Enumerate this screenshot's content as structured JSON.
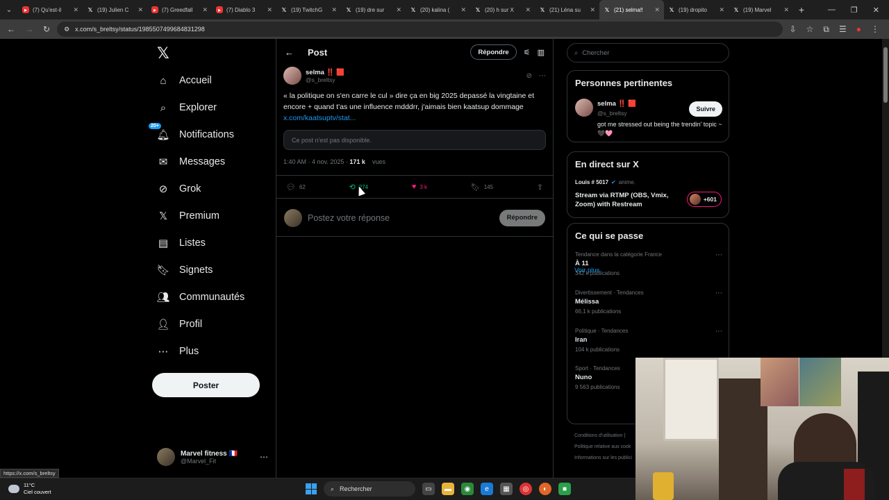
{
  "browser": {
    "tabs": [
      {
        "title": "(7) Qu'est-il",
        "icon": "youtube-icon"
      },
      {
        "title": "(19) Julien C",
        "icon": "x-icon"
      },
      {
        "title": "(7) Greedfall",
        "icon": "youtube-icon"
      },
      {
        "title": "(7) Diablo 3",
        "icon": "youtube-icon"
      },
      {
        "title": "(19) TwitchG",
        "icon": "x-icon"
      },
      {
        "title": "(19) dre sur",
        "icon": "x-icon"
      },
      {
        "title": "(20) kalina (",
        "icon": "x-icon"
      },
      {
        "title": "(20) h sur X",
        "icon": "x-icon"
      },
      {
        "title": "(21) Léna su",
        "icon": "x-icon"
      },
      {
        "title": "(21) selma‼",
        "icon": "x-icon",
        "active": true
      },
      {
        "title": "(19) dropito",
        "icon": "x-icon"
      },
      {
        "title": "(19) Marvel",
        "icon": "x-icon"
      }
    ],
    "url": "x.com/s_breltsy/status/1985507499684831298",
    "status_url": "https://x.com/s_breltsy"
  },
  "nav": {
    "items": [
      {
        "label": "Accueil",
        "icon": "home-icon"
      },
      {
        "label": "Explorer",
        "icon": "search-icon"
      },
      {
        "label": "Notifications",
        "icon": "bell-icon",
        "badge": "20+"
      },
      {
        "label": "Messages",
        "icon": "mail-icon"
      },
      {
        "label": "Grok",
        "icon": "grok-icon"
      },
      {
        "label": "Premium",
        "icon": "x-logo-icon"
      },
      {
        "label": "Listes",
        "icon": "list-icon"
      },
      {
        "label": "Signets",
        "icon": "bookmark-icon"
      },
      {
        "label": "Communautés",
        "icon": "communities-icon"
      },
      {
        "label": "Profil",
        "icon": "profile-icon"
      },
      {
        "label": "Plus",
        "icon": "more-icon"
      }
    ],
    "post_button": "Poster",
    "account": {
      "name": "Marvel fitness 🇫🇷",
      "handle": "@Marvel_Fit"
    }
  },
  "header": {
    "title": "Post",
    "reply_button": "Répondre"
  },
  "tweet": {
    "name": "selma",
    "name_emoji": "‼️ 🟥",
    "handle": "@s_breltsy",
    "text": "« la politique on s'en carre le cul » dire ça en big 2025 depassé la vingtaine et encore + quand t'as une influence mdddrr, j'aimais bien kaatsup dommage ",
    "link": "x.com/kaatsuptv/stat...",
    "unavailable": "Ce post n'est pas disponible.",
    "time": "1:40 AM · 4 nov. 2025 · ",
    "views_count": "171 k",
    "views_label": "vues",
    "replies": "62",
    "reposts": "274",
    "likes": "3 k",
    "bookmarks": "145"
  },
  "reply": {
    "placeholder": "Postez votre réponse",
    "button": "Répondre"
  },
  "right": {
    "search_placeholder": "Chercher",
    "relevant": {
      "title": "Personnes pertinentes",
      "name": "selma",
      "name_emoji": "‼️ 🟥",
      "handle": "@s_breltsy",
      "follow": "Suivre",
      "bio": "got me stressed out being the trendin' topic ~ ",
      "bio_emoji": "🖤🩷"
    },
    "live": {
      "title": "En direct sur X",
      "host": "Louis # 5017",
      "host_tag": "anime.",
      "stream_title": "Stream via RTMP (OBS, Vmix, Zoom) with Restream",
      "count": "+601"
    },
    "trends": {
      "title": "Ce qui se passe",
      "items": [
        {
          "category": "Tendance dans la catégorie France",
          "name": "À 11",
          "count": "342 k publications"
        },
        {
          "category": "Divertissement · Tendances",
          "name": "Mélissa",
          "count": "66,1 k publications"
        },
        {
          "category": "Politique · Tendances",
          "name": "Iran",
          "count": "104 k publications"
        },
        {
          "category": "Sport · Tendances",
          "name": "Nuno",
          "count": "9 563 publications"
        }
      ],
      "more_link": "Voir plus"
    },
    "footer": [
      "Conditions d'utilisation  |",
      "Politique relative aux cook",
      "Informations sur les publici"
    ]
  },
  "taskbar": {
    "temp": "11°C",
    "weather": "Ciel couvert",
    "search": "Rechercher"
  }
}
